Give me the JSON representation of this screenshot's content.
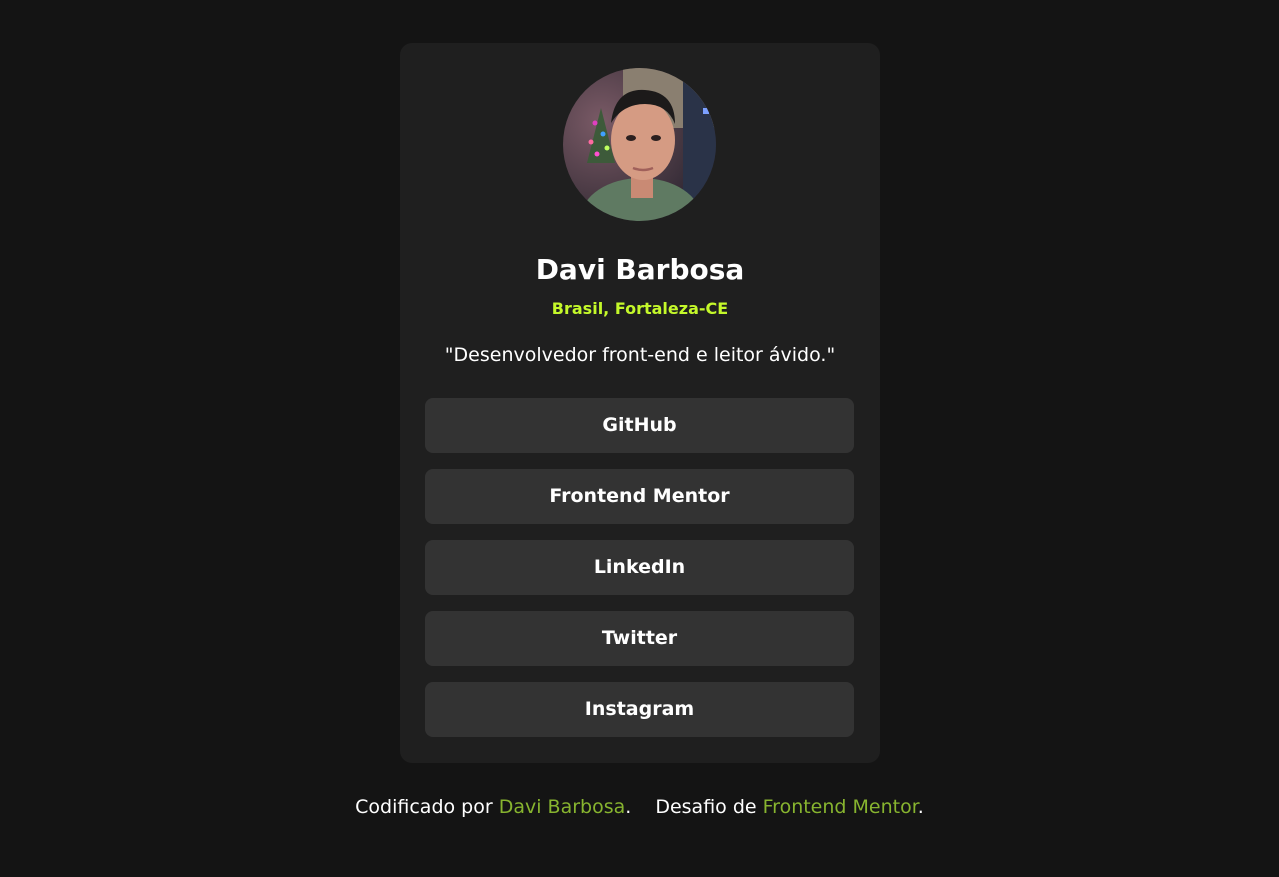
{
  "profile": {
    "name": "Davi Barbosa",
    "location": "Brasil, Fortaleza-CE",
    "bio": "\"Desenvolvedor front-end e leitor ávido.\""
  },
  "links": [
    {
      "label": "GitHub"
    },
    {
      "label": "Frontend Mentor"
    },
    {
      "label": "LinkedIn"
    },
    {
      "label": "Twitter"
    },
    {
      "label": "Instagram"
    }
  ],
  "footer": {
    "coded_by_prefix": "Codificado por ",
    "coded_by_name": "Davi Barbosa",
    "period1": ".",
    "challenge_prefix": "Desafio de ",
    "challenge_name": "Frontend Mentor",
    "period2": "."
  },
  "colors": {
    "background": "#141414",
    "card": "#1f1f1f",
    "button": "#333333",
    "accent": "#c4f82a",
    "footer_link": "#87b42f"
  }
}
